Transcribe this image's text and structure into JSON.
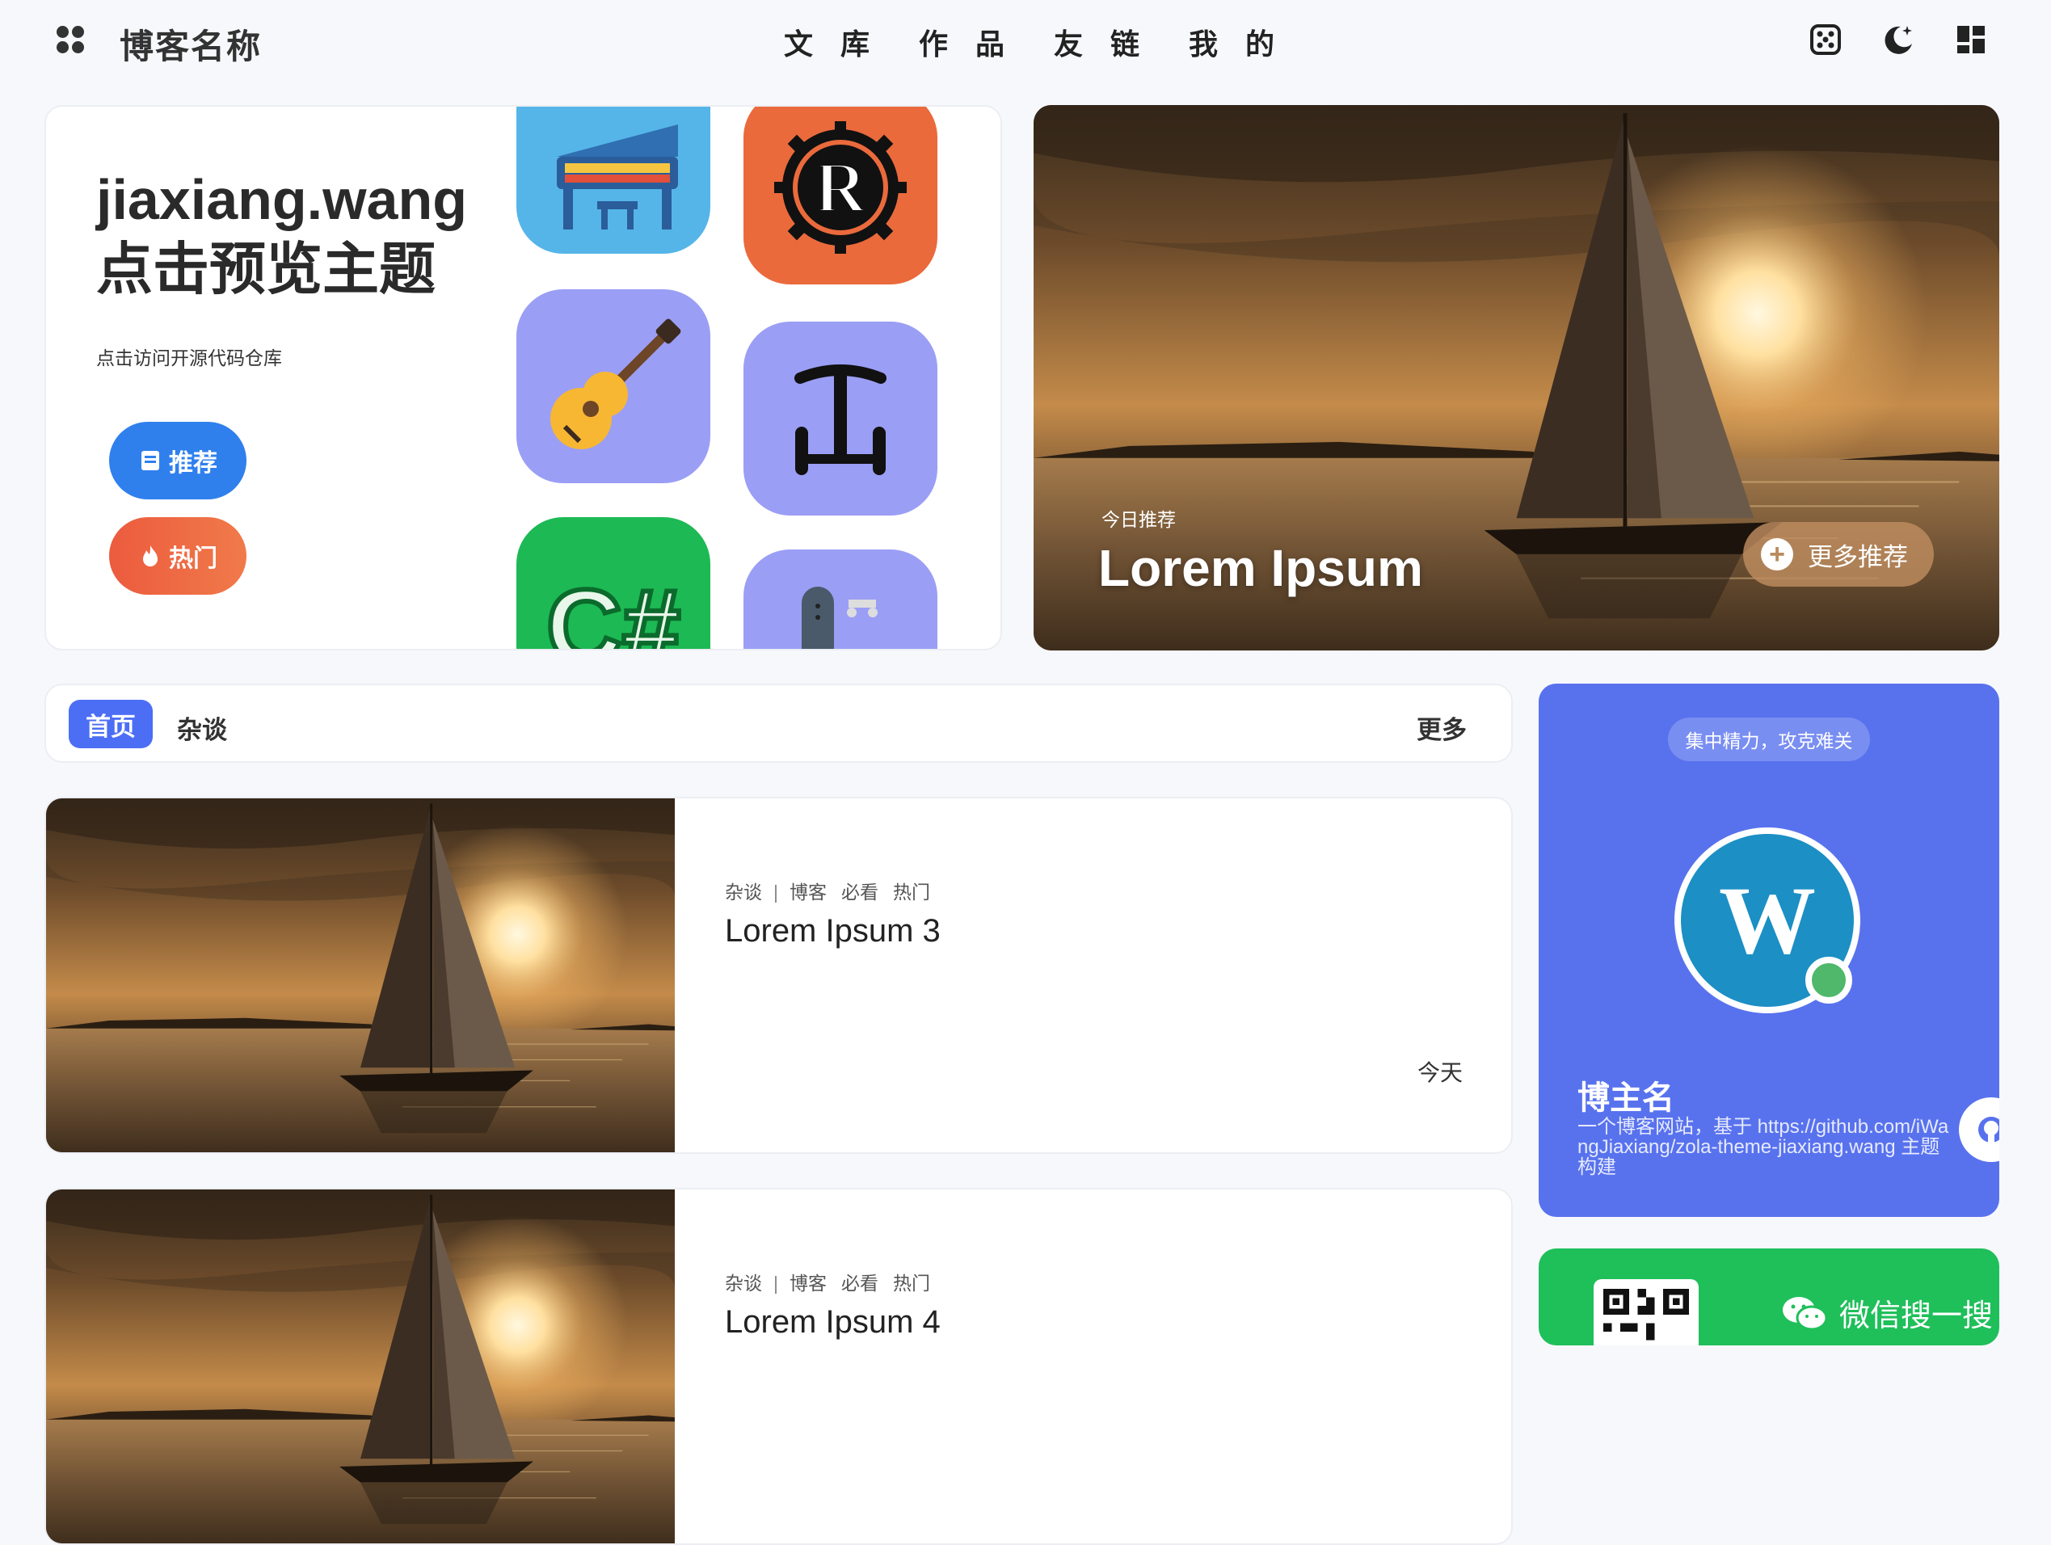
{
  "header": {
    "site_name": "博客名称",
    "nav": [
      "文 库",
      "作 品",
      "友 链",
      "我 的"
    ]
  },
  "hero": {
    "title_line1": "jiaxiang.wang",
    "title_line2": "点击预览主题",
    "subtitle": "点击访问开源代码仓库",
    "btn_recommend": "推荐",
    "btn_hot": "热门",
    "app_icons": [
      "piano-app",
      "rust-app",
      "guitar-app",
      "balance-app",
      "csharp-app",
      "skateboard-app"
    ]
  },
  "featured": {
    "label": "今日推荐",
    "title": "Lorem Ipsum",
    "more_button": "更多推荐"
  },
  "tabs": {
    "active": "首页",
    "items": [
      "杂谈"
    ],
    "more": "更多"
  },
  "articles": [
    {
      "category": "杂谈",
      "tags": [
        "博客",
        "必看",
        "热门"
      ],
      "title": "Lorem Ipsum 3",
      "date": "今天"
    },
    {
      "category": "杂谈",
      "tags": [
        "博客",
        "必看",
        "热门"
      ],
      "title": "Lorem Ipsum 4"
    }
  ],
  "profile": {
    "motto": "集中精力，攻克难关",
    "avatar_letter": "W",
    "name": "博主名",
    "description": "一个博客网站，基于 https://github.com/iWangJiaxiang/zola-theme-jiaxiang.wang 主题构建"
  },
  "wechat": {
    "label": "微信搜一搜"
  },
  "colors": {
    "accent_blue": "#4c6ef5",
    "profile_bg": "#5872ee",
    "wechat_green": "#1fbf5a",
    "hot_orange": "#ec5b3e",
    "recommend_blue": "#2f80ed"
  }
}
